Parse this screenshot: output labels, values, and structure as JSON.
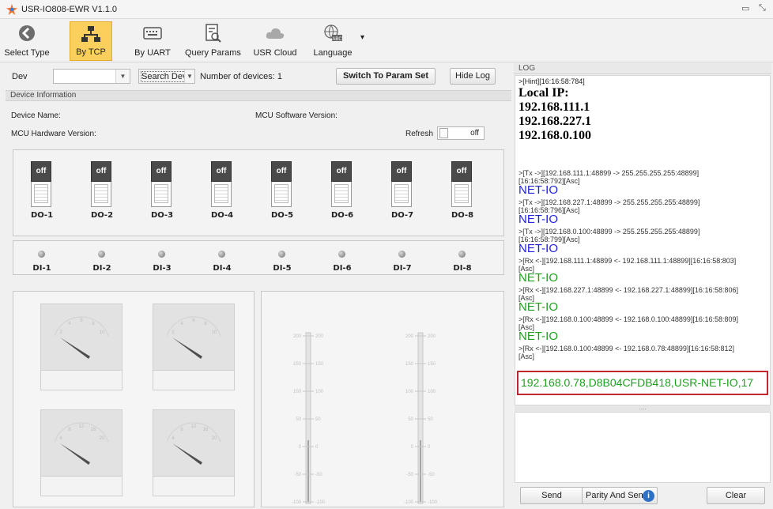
{
  "window": {
    "title": "USR-IO808-EWR V1.1.0",
    "minimize": "▭",
    "close": "⤡"
  },
  "toolbar": {
    "items": [
      {
        "label": "Select Type",
        "icon": "back-arrow-icon"
      },
      {
        "label": "By TCP",
        "icon": "network-icon",
        "active": true
      },
      {
        "label": "By UART",
        "icon": "keyboard-icon"
      },
      {
        "label": "Query Params",
        "icon": "query-document-icon"
      },
      {
        "label": "USR Cloud",
        "icon": "cloud-icon"
      },
      {
        "label": "Language",
        "icon": "globe-abc-icon"
      }
    ],
    "dropdown": "▾"
  },
  "device_bar": {
    "dev_label": "Dev",
    "dev_value": "",
    "search_label": "Search Dev",
    "device_count": "Number of devices: 1",
    "switch_button": "Switch To Param Set",
    "hide_log": "Hide Log"
  },
  "device_info": {
    "header": "Device Information",
    "name_label": "Device Name:",
    "mcu_sw_label": "MCU Software Version:",
    "mcu_hw_label": "MCU Hardware Version:",
    "refresh_label": "Refresh",
    "refresh_state": "off"
  },
  "outputs": [
    {
      "label": "DO-1",
      "state": "off"
    },
    {
      "label": "DO-2",
      "state": "off"
    },
    {
      "label": "DO-3",
      "state": "off"
    },
    {
      "label": "DO-4",
      "state": "off"
    },
    {
      "label": "DO-5",
      "state": "off"
    },
    {
      "label": "DO-6",
      "state": "off"
    },
    {
      "label": "DO-7",
      "state": "off"
    },
    {
      "label": "DO-8",
      "state": "off"
    }
  ],
  "inputs": [
    "DI-1",
    "DI-2",
    "DI-3",
    "DI-4",
    "DI-5",
    "DI-6",
    "DI-7",
    "DI-8"
  ],
  "gauges": {
    "top_ticks": [
      "2",
      "4",
      "6",
      "8",
      "10"
    ],
    "bottom_ticks": [
      "4",
      "8",
      "12",
      "16",
      "20"
    ]
  },
  "thermometers": {
    "ticks": [
      "200",
      "150",
      "100",
      "50",
      "0",
      "-50",
      "-100"
    ]
  },
  "log": {
    "header": "LOG",
    "hint": ">[Hint][16:16:58:784]",
    "local_ip_title": "Local IP:",
    "local_ips": [
      "192.168.111.1",
      "192.168.227.1",
      "192.168.0.100"
    ],
    "entries": [
      {
        "meta": ">[Tx ->][192.168.111.1:48899 -> 255.255.255.255:48899]",
        "meta2": "[16:16:58:792][Asc]",
        "text": "NET-IO",
        "kind": "tx"
      },
      {
        "meta": ">[Tx ->][192.168.227.1:48899 -> 255.255.255.255:48899]",
        "meta2": "[16:16:58:796][Asc]",
        "text": "NET-IO",
        "kind": "tx"
      },
      {
        "meta": ">[Tx ->][192.168.0.100:48899 -> 255.255.255.255:48899]",
        "meta2": "[16:16:58:799][Asc]",
        "text": "NET-IO",
        "kind": "tx"
      },
      {
        "meta": ">[Rx <-][192.168.111.1:48899 <- 192.168.111.1:48899][16:16:58:803]",
        "meta2": "[Asc]",
        "text": "NET-IO",
        "kind": "rx"
      },
      {
        "meta": ">[Rx <-][192.168.227.1:48899 <- 192.168.227.1:48899][16:16:58:806]",
        "meta2": "[Asc]",
        "text": "NET-IO",
        "kind": "rx"
      },
      {
        "meta": ">[Rx <-][192.168.0.100:48899 <- 192.168.0.100:48899][16:16:58:809]",
        "meta2": "[Asc]",
        "text": "NET-IO",
        "kind": "rx"
      },
      {
        "meta": ">[Rx <-][192.168.0.100:48899 <- 192.168.0.78:48899][16:16:58:812]",
        "meta2": "[Asc]",
        "text": "",
        "kind": "rx"
      }
    ],
    "highlight": "192.168.0.78,D8B04CFDB418,USR-NET-IO,17",
    "splitter": "....",
    "send_button": "Send",
    "parity_button": "Parity And Send",
    "info_icon": "i",
    "clear_button": "Clear"
  },
  "colors": {
    "active_tab": "#fbcf5b",
    "tx_text": "#2222dd",
    "rx_text": "#1ea01e",
    "highlight_border": "#c1272d"
  }
}
